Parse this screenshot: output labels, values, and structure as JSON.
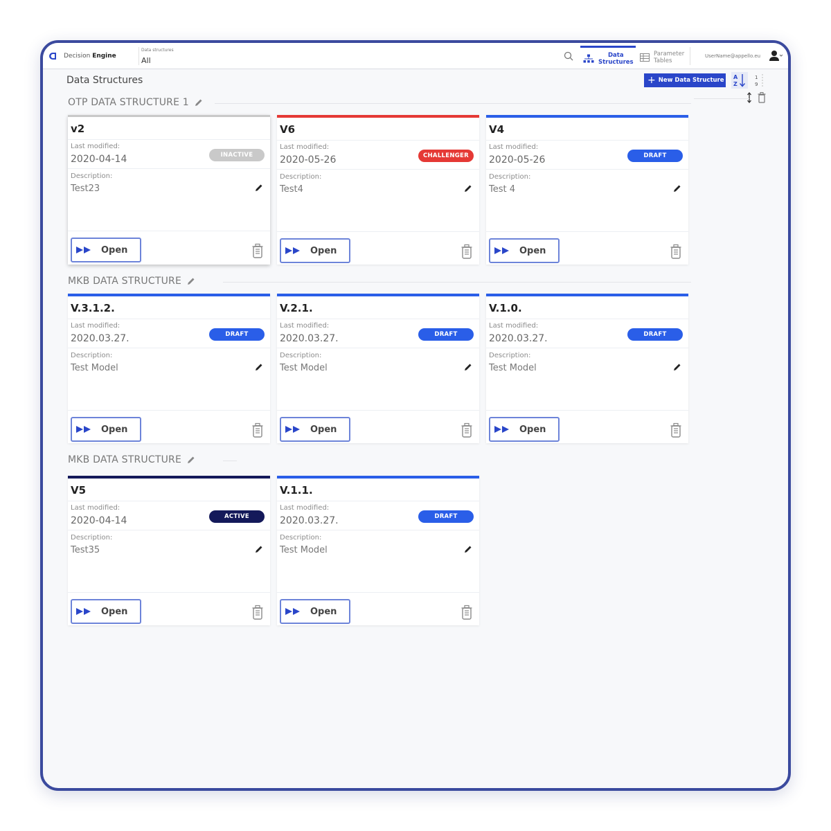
{
  "app": {
    "brand_prefix": "Decision ",
    "brand_bold": "Engine",
    "data_structures_label": "Data structures",
    "data_structures_value": "All"
  },
  "nav": {
    "data_structures_line1": "Data",
    "data_structures_line2": "Structures",
    "parameter_tables_line1": "Parameter",
    "parameter_tables_line2": "Tables",
    "user_name": "UserName@appello.eu"
  },
  "header": {
    "page_title": "Data Structures",
    "new_button_label": "New Data Structure"
  },
  "colors": {
    "accent": "#2a46c9",
    "draft": "#2a5ee8",
    "challenger": "#e53935",
    "active": "#14195a",
    "inactive": "#c9c9c9"
  },
  "labels": {
    "last_modified": "Last modified:",
    "description": "Description:",
    "open": "Open"
  },
  "sections": [
    {
      "title": "OTP DATA STRUCTURE 1",
      "cards": [
        {
          "title": "v2",
          "date": "2020-04-14",
          "status": "INACTIVE",
          "description": "Test23"
        },
        {
          "title": "V6",
          "date": "2020-05-26",
          "status": "CHALLENGER",
          "description": "Test4"
        },
        {
          "title": "V4",
          "date": "2020-05-26",
          "status": "DRAFT",
          "description": "Test 4"
        }
      ]
    },
    {
      "title": "MKB DATA STRUCTURE",
      "cards": [
        {
          "title": "V.3.1.2.",
          "date": "2020.03.27.",
          "status": "DRAFT",
          "description": "Test Model"
        },
        {
          "title": "V.2.1.",
          "date": "2020.03.27.",
          "status": "DRAFT",
          "description": "Test Model"
        },
        {
          "title": "V.1.0.",
          "date": "2020.03.27.",
          "status": "DRAFT",
          "description": "Test Model"
        }
      ]
    },
    {
      "title": "MKB DATA STRUCTURE",
      "cards": [
        {
          "title": "V5",
          "date": "2020-04-14",
          "status": "ACTIVE",
          "description": "Test35"
        },
        {
          "title": "V.1.1.",
          "date": "2020.03.27.",
          "status": "DRAFT",
          "description": "Test Model"
        }
      ]
    }
  ]
}
